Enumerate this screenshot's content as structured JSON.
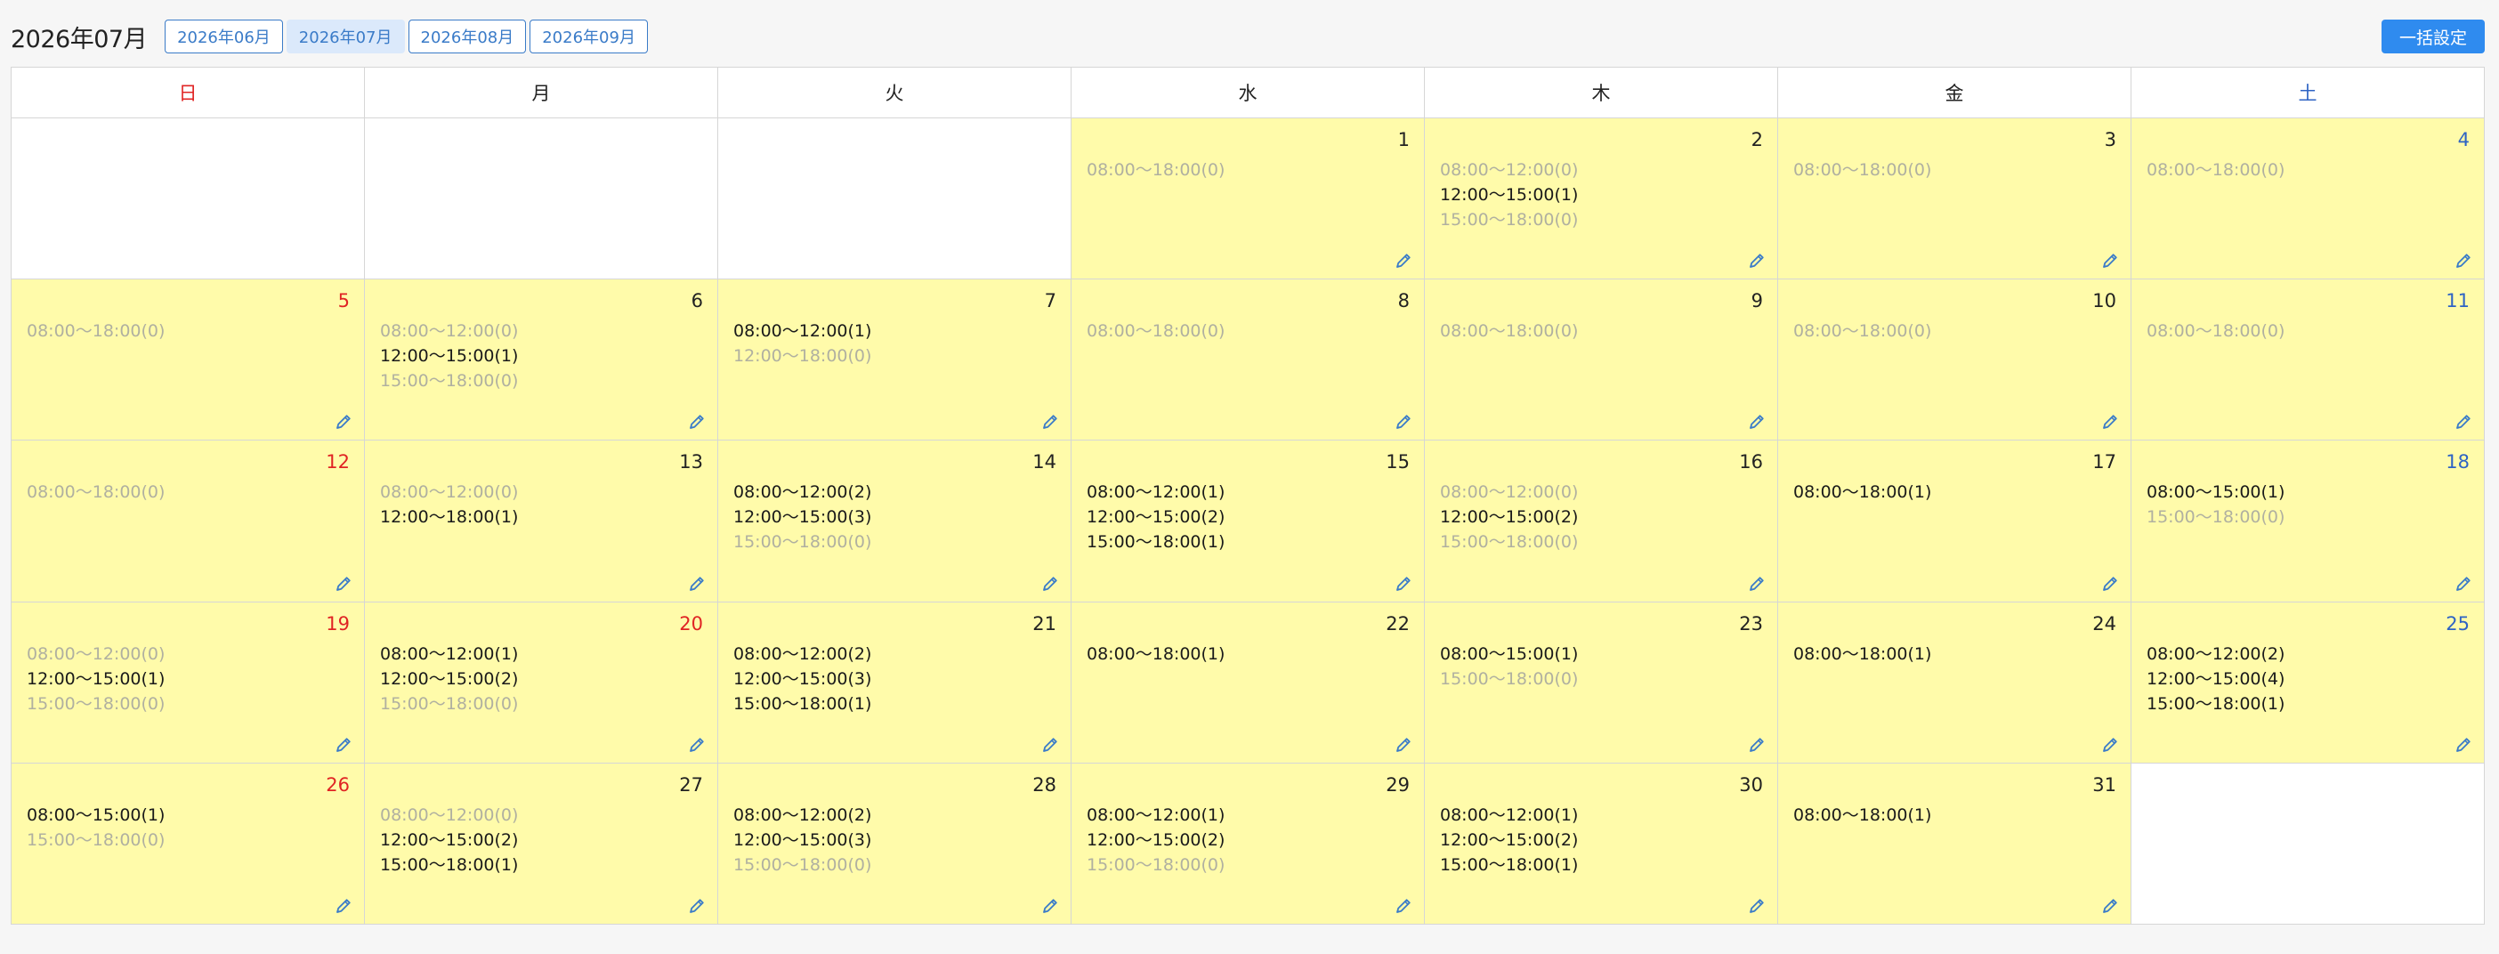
{
  "header": {
    "month_title": "2026年07月",
    "month_buttons": [
      {
        "label": "2026年06月",
        "active": false
      },
      {
        "label": "2026年07月",
        "active": true
      },
      {
        "label": "2026年08月",
        "active": false
      },
      {
        "label": "2026年09月",
        "active": false
      }
    ],
    "bulk_button": "一括設定"
  },
  "weekdays": [
    "日",
    "月",
    "火",
    "水",
    "木",
    "金",
    "土"
  ],
  "colors": {
    "sunday": "#e02424",
    "saturday": "#2e63c4",
    "active_cell": "#fffbaa",
    "accent": "#2f8bef"
  },
  "weeks": [
    [
      null,
      null,
      null,
      {
        "day": "1",
        "slots": [
          {
            "text": "08:00〜18:00(0)",
            "on": false
          }
        ]
      },
      {
        "day": "2",
        "slots": [
          {
            "text": "08:00〜12:00(0)",
            "on": false
          },
          {
            "text": "12:00〜15:00(1)",
            "on": true
          },
          {
            "text": "15:00〜18:00(0)",
            "on": false
          }
        ]
      },
      {
        "day": "3",
        "slots": [
          {
            "text": "08:00〜18:00(0)",
            "on": false
          }
        ]
      },
      {
        "day": "4",
        "slots": [
          {
            "text": "08:00〜18:00(0)",
            "on": false
          }
        ]
      }
    ],
    [
      {
        "day": "5",
        "slots": [
          {
            "text": "08:00〜18:00(0)",
            "on": false
          }
        ]
      },
      {
        "day": "6",
        "slots": [
          {
            "text": "08:00〜12:00(0)",
            "on": false
          },
          {
            "text": "12:00〜15:00(1)",
            "on": true
          },
          {
            "text": "15:00〜18:00(0)",
            "on": false
          }
        ]
      },
      {
        "day": "7",
        "slots": [
          {
            "text": "08:00〜12:00(1)",
            "on": true
          },
          {
            "text": "12:00〜18:00(0)",
            "on": false
          }
        ]
      },
      {
        "day": "8",
        "slots": [
          {
            "text": "08:00〜18:00(0)",
            "on": false
          }
        ]
      },
      {
        "day": "9",
        "slots": [
          {
            "text": "08:00〜18:00(0)",
            "on": false
          }
        ]
      },
      {
        "day": "10",
        "slots": [
          {
            "text": "08:00〜18:00(0)",
            "on": false
          }
        ]
      },
      {
        "day": "11",
        "slots": [
          {
            "text": "08:00〜18:00(0)",
            "on": false
          }
        ]
      }
    ],
    [
      {
        "day": "12",
        "slots": [
          {
            "text": "08:00〜18:00(0)",
            "on": false
          }
        ]
      },
      {
        "day": "13",
        "slots": [
          {
            "text": "08:00〜12:00(0)",
            "on": false
          },
          {
            "text": "12:00〜18:00(1)",
            "on": true
          }
        ]
      },
      {
        "day": "14",
        "slots": [
          {
            "text": "08:00〜12:00(2)",
            "on": true
          },
          {
            "text": "12:00〜15:00(3)",
            "on": true
          },
          {
            "text": "15:00〜18:00(0)",
            "on": false
          }
        ]
      },
      {
        "day": "15",
        "slots": [
          {
            "text": "08:00〜12:00(1)",
            "on": true
          },
          {
            "text": "12:00〜15:00(2)",
            "on": true
          },
          {
            "text": "15:00〜18:00(1)",
            "on": true
          }
        ]
      },
      {
        "day": "16",
        "slots": [
          {
            "text": "08:00〜12:00(0)",
            "on": false
          },
          {
            "text": "12:00〜15:00(2)",
            "on": true
          },
          {
            "text": "15:00〜18:00(0)",
            "on": false
          }
        ]
      },
      {
        "day": "17",
        "slots": [
          {
            "text": "08:00〜18:00(1)",
            "on": true
          }
        ]
      },
      {
        "day": "18",
        "slots": [
          {
            "text": "08:00〜15:00(1)",
            "on": true
          },
          {
            "text": "15:00〜18:00(0)",
            "on": false
          }
        ]
      }
    ],
    [
      {
        "day": "19",
        "slots": [
          {
            "text": "08:00〜12:00(0)",
            "on": false
          },
          {
            "text": "12:00〜15:00(1)",
            "on": true
          },
          {
            "text": "15:00〜18:00(0)",
            "on": false
          }
        ]
      },
      {
        "day": "20",
        "holiday": true,
        "slots": [
          {
            "text": "08:00〜12:00(1)",
            "on": true
          },
          {
            "text": "12:00〜15:00(2)",
            "on": true
          },
          {
            "text": "15:00〜18:00(0)",
            "on": false
          }
        ]
      },
      {
        "day": "21",
        "slots": [
          {
            "text": "08:00〜12:00(2)",
            "on": true
          },
          {
            "text": "12:00〜15:00(3)",
            "on": true
          },
          {
            "text": "15:00〜18:00(1)",
            "on": true
          }
        ]
      },
      {
        "day": "22",
        "slots": [
          {
            "text": "08:00〜18:00(1)",
            "on": true
          }
        ]
      },
      {
        "day": "23",
        "slots": [
          {
            "text": "08:00〜15:00(1)",
            "on": true
          },
          {
            "text": "15:00〜18:00(0)",
            "on": false
          }
        ]
      },
      {
        "day": "24",
        "slots": [
          {
            "text": "08:00〜18:00(1)",
            "on": true
          }
        ]
      },
      {
        "day": "25",
        "slots": [
          {
            "text": "08:00〜12:00(2)",
            "on": true
          },
          {
            "text": "12:00〜15:00(4)",
            "on": true
          },
          {
            "text": "15:00〜18:00(1)",
            "on": true
          }
        ]
      }
    ],
    [
      {
        "day": "26",
        "slots": [
          {
            "text": "08:00〜15:00(1)",
            "on": true
          },
          {
            "text": "15:00〜18:00(0)",
            "on": false
          }
        ]
      },
      {
        "day": "27",
        "slots": [
          {
            "text": "08:00〜12:00(0)",
            "on": false
          },
          {
            "text": "12:00〜15:00(2)",
            "on": true
          },
          {
            "text": "15:00〜18:00(1)",
            "on": true
          }
        ]
      },
      {
        "day": "28",
        "slots": [
          {
            "text": "08:00〜12:00(2)",
            "on": true
          },
          {
            "text": "12:00〜15:00(3)",
            "on": true
          },
          {
            "text": "15:00〜18:00(0)",
            "on": false
          }
        ]
      },
      {
        "day": "29",
        "slots": [
          {
            "text": "08:00〜12:00(1)",
            "on": true
          },
          {
            "text": "12:00〜15:00(2)",
            "on": true
          },
          {
            "text": "15:00〜18:00(0)",
            "on": false
          }
        ]
      },
      {
        "day": "30",
        "slots": [
          {
            "text": "08:00〜12:00(1)",
            "on": true
          },
          {
            "text": "12:00〜15:00(2)",
            "on": true
          },
          {
            "text": "15:00〜18:00(1)",
            "on": true
          }
        ]
      },
      {
        "day": "31",
        "slots": [
          {
            "text": "08:00〜18:00(1)",
            "on": true
          }
        ]
      },
      null
    ]
  ]
}
